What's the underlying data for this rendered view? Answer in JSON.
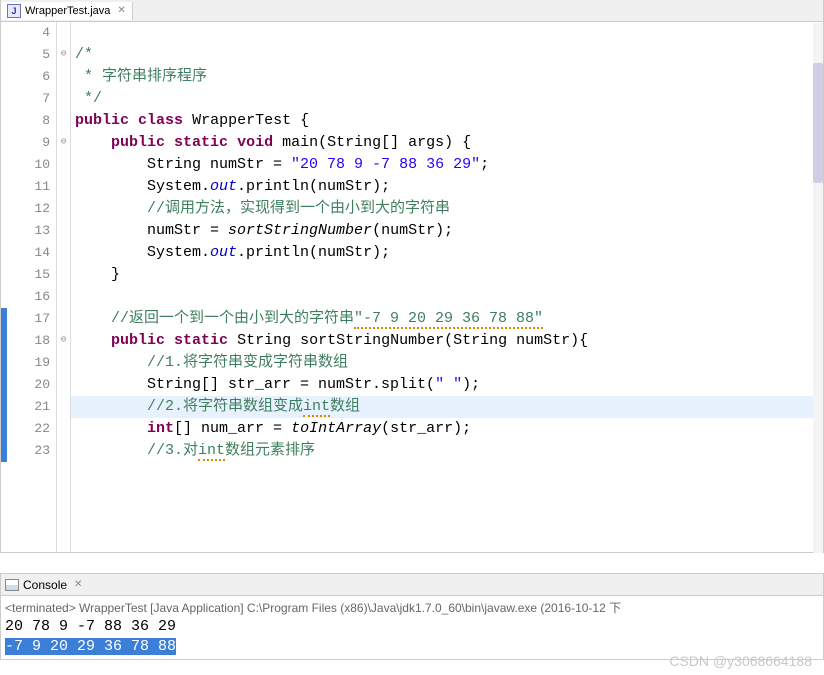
{
  "tab": {
    "filename": "WrapperTest.java",
    "icon_letter": "J"
  },
  "code": {
    "lines": [
      {
        "num": "4",
        "fold": "",
        "marker": "",
        "hl": false,
        "html": ""
      },
      {
        "num": "5",
        "fold": "⊖",
        "marker": "",
        "hl": false,
        "html": "<span class='cmt'>/*</span>"
      },
      {
        "num": "6",
        "fold": "",
        "marker": "",
        "hl": false,
        "html": " <span class='cmt'>* 字符串排序程序</span>"
      },
      {
        "num": "7",
        "fold": "",
        "marker": "",
        "hl": false,
        "html": " <span class='cmt'>*/</span>"
      },
      {
        "num": "8",
        "fold": "",
        "marker": "",
        "hl": false,
        "html": "<span class='kw'>public</span> <span class='kw'>class</span> <span class='cls'>WrapperTest</span> {"
      },
      {
        "num": "9",
        "fold": "⊖",
        "marker": "",
        "hl": false,
        "html": "    <span class='kw'>public</span> <span class='kw'>static</span> <span class='kw'>void</span> main(String[] args) {"
      },
      {
        "num": "10",
        "fold": "",
        "marker": "",
        "hl": false,
        "html": "        String numStr = <span class='str'>\"20 78 9 -7 88 36 29\"</span>;"
      },
      {
        "num": "11",
        "fold": "",
        "marker": "",
        "hl": false,
        "html": "        System.<span class='field'>out</span>.println(numStr);"
      },
      {
        "num": "12",
        "fold": "",
        "marker": "",
        "hl": false,
        "html": "        <span class='cmt'>//调用方法，实现得到一个由小到大的字符串</span>"
      },
      {
        "num": "13",
        "fold": "",
        "marker": "",
        "hl": false,
        "html": "        numStr = <span class='method-i'>sortStringNumber</span>(numStr);"
      },
      {
        "num": "14",
        "fold": "",
        "marker": "",
        "hl": false,
        "html": "        System.<span class='field'>out</span>.println(numStr);"
      },
      {
        "num": "15",
        "fold": "",
        "marker": "",
        "hl": false,
        "html": "    }"
      },
      {
        "num": "16",
        "fold": "",
        "marker": "",
        "hl": false,
        "html": ""
      },
      {
        "num": "17",
        "fold": "",
        "marker": "blue",
        "hl": false,
        "html": "    <span class='cmt'>//返回一个到一个由小到大的字符串<span class='squiggle'>\"-7 9 20 29 36 78 88\"</span></span>"
      },
      {
        "num": "18",
        "fold": "⊖",
        "marker": "blue",
        "hl": false,
        "html": "    <span class='kw'>public</span> <span class='kw'>static</span> String sortStringNumber(String numStr){"
      },
      {
        "num": "19",
        "fold": "",
        "marker": "blue",
        "hl": false,
        "html": "        <span class='cmt'>//1.将字符串变成字符串数组</span>"
      },
      {
        "num": "20",
        "fold": "",
        "marker": "blue",
        "hl": false,
        "html": "        String[] str_arr = numStr.split(<span class='str'>\" \"</span>);"
      },
      {
        "num": "21",
        "fold": "",
        "marker": "blue",
        "hl": true,
        "html": "        <span class='cmt'>//2.将字符串数组变成<span class='squiggle'>int</span>数组</span>"
      },
      {
        "num": "22",
        "fold": "",
        "marker": "blue",
        "hl": false,
        "html": "        <span class='kw'>int</span>[] num_arr = <span class='method-i'>toIntArray</span>(str_arr);"
      },
      {
        "num": "23",
        "fold": "",
        "marker": "blue",
        "hl": false,
        "html": "        <span class='cmt'>//3.对<span class='squiggle'>int</span>数组元素排序</span>"
      }
    ]
  },
  "console": {
    "label": "Console",
    "meta": "<terminated> WrapperTest [Java Application] C:\\Program Files (x86)\\Java\\jdk1.7.0_60\\bin\\javaw.exe (2016-10-12 下",
    "out1": "20 78 9 -7 88 36 29",
    "out2": "-7 9 20 29 36 78 88"
  },
  "watermark": "CSDN @y3068664188"
}
